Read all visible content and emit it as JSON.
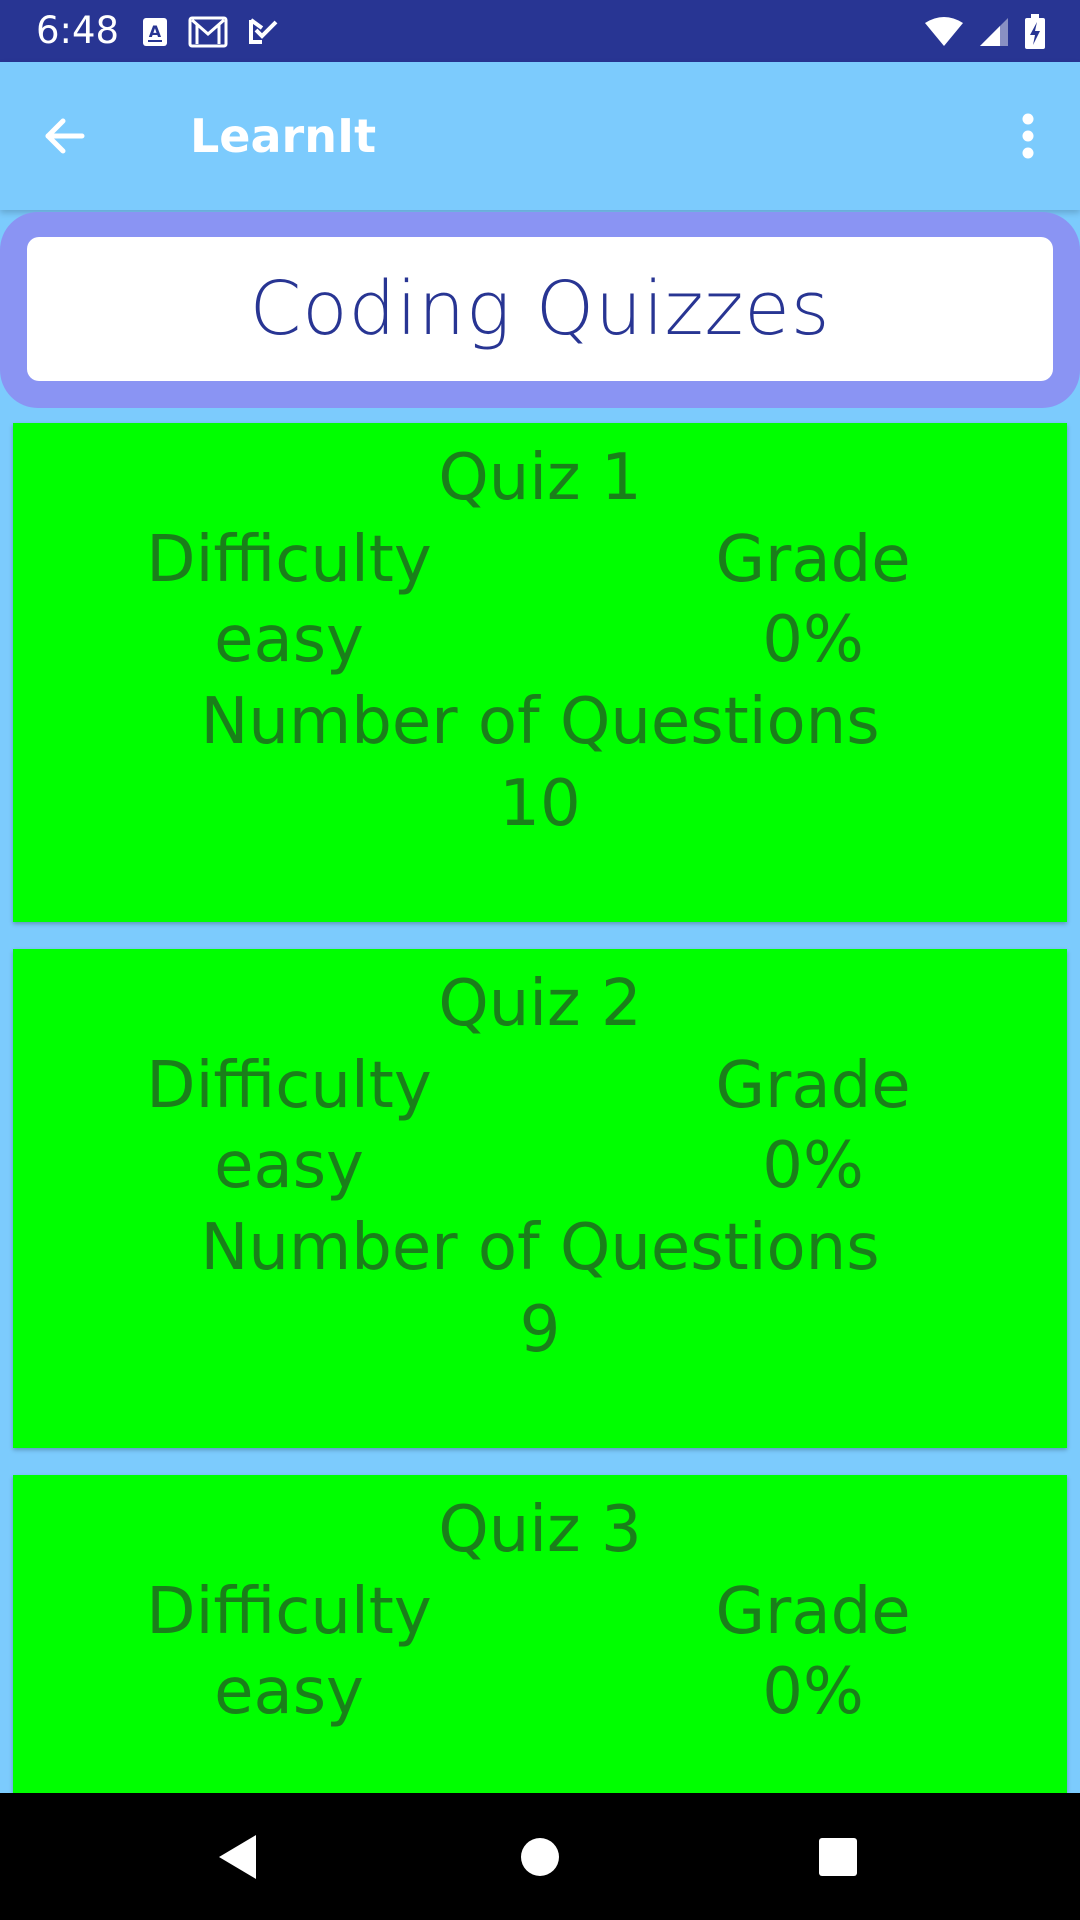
{
  "status_bar": {
    "time": "6:48",
    "left_icons": [
      "text-notification-icon",
      "gmail-icon",
      "tasks-check-icon"
    ],
    "right_icons": [
      "wifi-icon",
      "cell-signal-icon",
      "battery-charging-icon"
    ],
    "background": "#283593"
  },
  "app_bar": {
    "title": "LearnIt",
    "back_icon": "arrow-back-icon",
    "overflow_icon": "more-vert-icon",
    "background": "#7ccbfd"
  },
  "header": {
    "title": "Coding Quizzes",
    "frame_color": "#8a94f3",
    "text_color": "#283593"
  },
  "quiz_card_labels": {
    "difficulty": "Difficulty",
    "grade": "Grade",
    "number_of_questions": "Number of Questions"
  },
  "quizzes": [
    {
      "title": "Quiz 1",
      "difficulty": "easy",
      "grade": "0%",
      "num_questions": "10"
    },
    {
      "title": "Quiz 2",
      "difficulty": "easy",
      "grade": "0%",
      "num_questions": "9"
    },
    {
      "title": "Quiz 3",
      "difficulty": "easy",
      "grade": "0%",
      "num_questions": ""
    }
  ],
  "colors": {
    "card_background": "#00ff00",
    "card_text": "#1a7f1a",
    "page_background": "#7ccbfd",
    "nav_bar": "#000000"
  },
  "nav_bar": {
    "buttons": [
      "nav-back-icon",
      "nav-home-icon",
      "nav-recents-icon"
    ]
  }
}
